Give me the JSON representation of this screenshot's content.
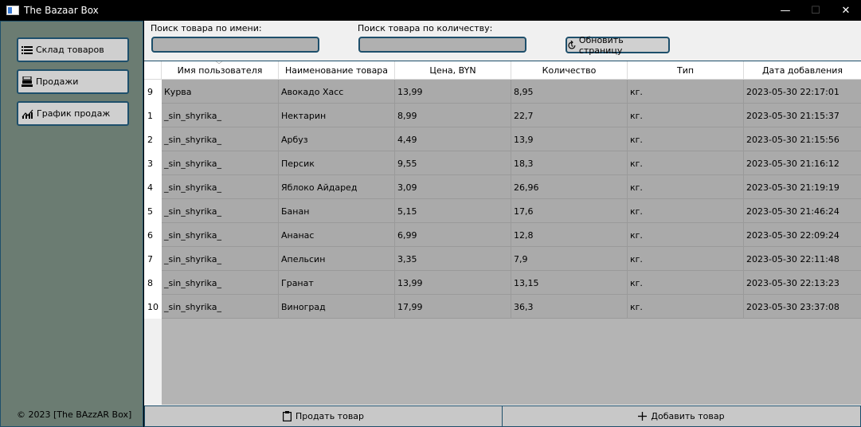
{
  "window": {
    "title": "The Bazaar Box",
    "minimize": "—",
    "maximize": "☐",
    "close": "✕"
  },
  "sidebar": {
    "items": [
      {
        "label": "Склад товаров",
        "icon": "list-icon"
      },
      {
        "label": "Продажи",
        "icon": "cash-register-icon"
      },
      {
        "label": "График продаж",
        "icon": "chart-icon"
      }
    ],
    "copyright": "© 2023 [The BAzzAR Box]"
  },
  "search": {
    "by_name_label": "Поиск товара по имени:",
    "by_name_value": "",
    "by_qty_label": "Поиск товара по количеству:",
    "by_qty_value": "",
    "refresh_label": "Обновить страницу"
  },
  "table": {
    "columns": [
      "Имя пользователя",
      "Наименование товара",
      "Цена, BYN",
      "Количество",
      "Тип",
      "Дата добавления"
    ],
    "sorted_column": 0,
    "rows": [
      {
        "id": "9",
        "cells": [
          "Курва",
          "Авокадо Хасс",
          "13,99",
          "8,95",
          "кг.",
          "2023-05-30 22:17:01"
        ]
      },
      {
        "id": "1",
        "cells": [
          "_sin_shyrika_",
          "Нектарин",
          "8,99",
          "22,7",
          "кг.",
          "2023-05-30 21:15:37"
        ]
      },
      {
        "id": "2",
        "cells": [
          "_sin_shyrika_",
          "Арбуз",
          "4,49",
          "13,9",
          "кг.",
          "2023-05-30 21:15:56"
        ]
      },
      {
        "id": "3",
        "cells": [
          "_sin_shyrika_",
          "Персик",
          "9,55",
          "18,3",
          "кг.",
          "2023-05-30 21:16:12"
        ]
      },
      {
        "id": "4",
        "cells": [
          "_sin_shyrika_",
          "Яблоко Айдаред",
          "3,09",
          "26,96",
          "кг.",
          "2023-05-30 21:19:19"
        ]
      },
      {
        "id": "5",
        "cells": [
          "_sin_shyrika_",
          "Банан",
          "5,15",
          "17,6",
          "кг.",
          "2023-05-30 21:46:24"
        ]
      },
      {
        "id": "6",
        "cells": [
          "_sin_shyrika_",
          "Ананас",
          "6,99",
          "12,8",
          "кг.",
          "2023-05-30 22:09:24"
        ]
      },
      {
        "id": "7",
        "cells": [
          "_sin_shyrika_",
          "Апельсин",
          "3,35",
          "7,9",
          "кг.",
          "2023-05-30 22:11:48"
        ]
      },
      {
        "id": "8",
        "cells": [
          "_sin_shyrika_",
          "Гранат",
          "13,99",
          "13,15",
          "кг.",
          "2023-05-30 22:13:23"
        ]
      },
      {
        "id": "10",
        "cells": [
          "_sin_shyrika_",
          "Виноград",
          "17,99",
          "36,3",
          "кг.",
          "2023-05-30 23:37:08"
        ]
      }
    ]
  },
  "actions": {
    "sell_label": "Продать товар",
    "add_label": "Добавить товар"
  },
  "colors": {
    "sidebar_bg": "#6b7c72",
    "border_accent": "#1e4f6b",
    "row_bg": "#aaaaaa"
  }
}
